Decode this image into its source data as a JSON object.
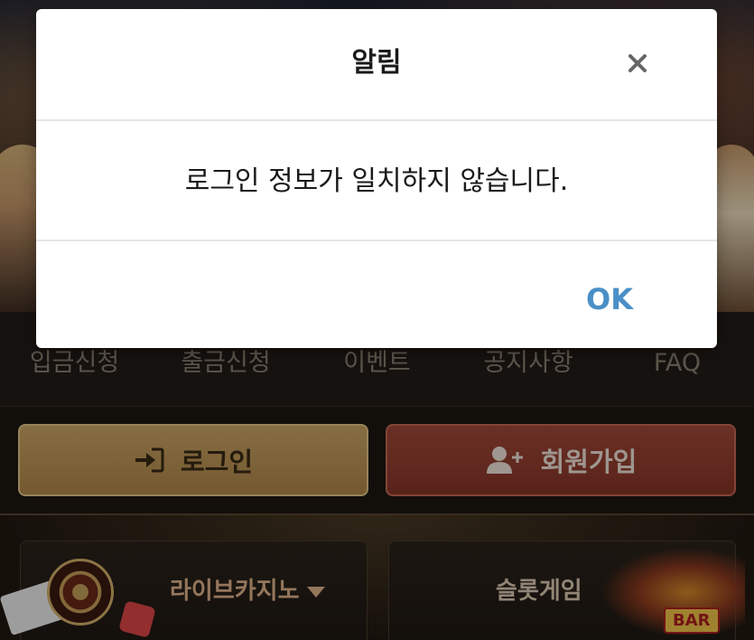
{
  "nav": {
    "items": [
      {
        "label": "입금신청"
      },
      {
        "label": "출금신청"
      },
      {
        "label": "이벤트"
      },
      {
        "label": "공지사항"
      },
      {
        "label": "FAQ"
      }
    ]
  },
  "auth": {
    "login_label": "로그인",
    "login_icon": "sign-in-icon",
    "register_label": "회원가입",
    "register_icon": "user-plus-icon"
  },
  "games": {
    "live_casino_label": "라이브카지노",
    "slot_label": "슬롯게임",
    "slot_badge": "BAR"
  },
  "dialog": {
    "title": "알림",
    "message": "로그인 정보가 일치하지 않습니다.",
    "ok_label": "OK",
    "close_icon": "close-icon"
  },
  "colors": {
    "ok_accent": "#4a8fc7",
    "login_button": "#c49c5a",
    "register_button": "#963f30"
  }
}
